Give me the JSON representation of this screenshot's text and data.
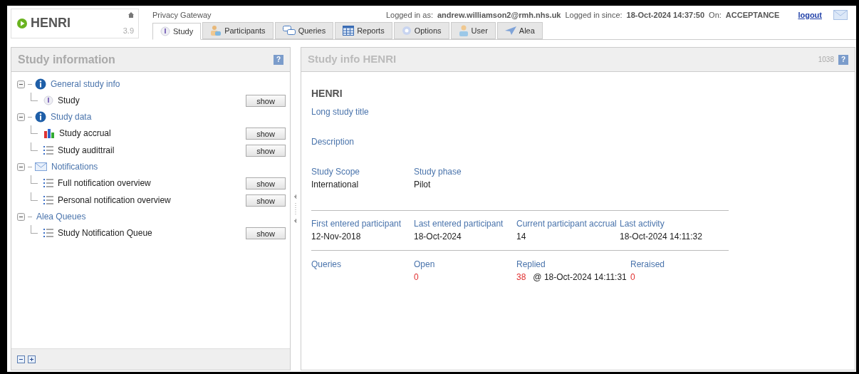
{
  "app": {
    "name": "HENRI",
    "version": "3.9",
    "subtitle": "Privacy Gateway"
  },
  "login": {
    "user_label": "Logged in as:",
    "user": "andrew.williamson2@rmh.nhs.uk",
    "since_label": "Logged in since:",
    "since": "18-Oct-2024 14:37:50",
    "on_label": "On:",
    "on": "ACCEPTANCE",
    "logout": "logout"
  },
  "tabs": [
    {
      "label": "Study",
      "kind": "info",
      "selected": true
    },
    {
      "label": "Participants",
      "kind": "people",
      "selected": false
    },
    {
      "label": "Queries",
      "kind": "chat",
      "selected": false
    },
    {
      "label": "Reports",
      "kind": "table",
      "selected": false
    },
    {
      "label": "Options",
      "kind": "gear",
      "selected": false
    },
    {
      "label": "User",
      "kind": "user",
      "selected": false
    },
    {
      "label": "Alea",
      "kind": "plane",
      "selected": false
    }
  ],
  "left_panel": {
    "title": "Study information",
    "help": "?",
    "tree": [
      {
        "label": "General study info",
        "kind": "info",
        "expanded": true,
        "children": [
          {
            "label": "Study",
            "kind": "info",
            "button": "show"
          }
        ]
      },
      {
        "label": "Study data",
        "kind": "info",
        "expanded": true,
        "children": [
          {
            "label": "Study accrual",
            "kind": "chart",
            "button": "show"
          },
          {
            "label": "Study audittrail",
            "kind": "list",
            "button": "show"
          }
        ]
      },
      {
        "label": "Notifications",
        "kind": "mail",
        "expanded": true,
        "children": [
          {
            "label": "Full notification overview",
            "kind": "list",
            "button": "show"
          },
          {
            "label": "Personal notification overview",
            "kind": "list",
            "button": "show"
          }
        ]
      },
      {
        "label": "Alea Queues",
        "kind": "plain",
        "expanded": true,
        "children": [
          {
            "label": "Study Notification Queue",
            "kind": "list",
            "button": "show"
          }
        ]
      }
    ]
  },
  "right_panel": {
    "title": "Study info HENRI",
    "corner_number": "1038",
    "help": "?",
    "study_name": "HENRI",
    "fields": [
      {
        "label": "Long study title"
      },
      {
        "label": "Description"
      }
    ],
    "scope_row": [
      {
        "label": "Study Scope",
        "value": "International"
      },
      {
        "label": "Study phase",
        "value": "Pilot"
      }
    ],
    "participant_row": [
      {
        "label": "First entered participant",
        "value": "12-Nov-2018"
      },
      {
        "label": "Last entered participant",
        "value": "18-Oct-2024"
      },
      {
        "label": "Current participant accrual",
        "value": "14"
      },
      {
        "label": "Last activity",
        "value": "18-Oct-2024 14:11:32"
      }
    ],
    "queries": {
      "label": "Queries",
      "open_label": "Open",
      "open": "0",
      "replied_label": "Replied",
      "replied": "38",
      "replied_at": "@ 18-Oct-2024 14:11:31",
      "reraised_label": "Reraised",
      "reraised": "0"
    }
  }
}
